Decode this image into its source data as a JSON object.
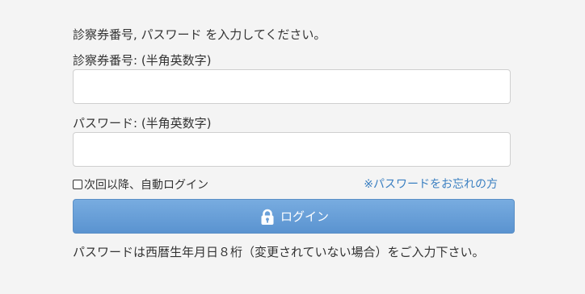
{
  "form": {
    "instruction": "診察券番号, パスワード を入力してください。",
    "card_number": {
      "label": "診察券番号: (半角英数字)",
      "value": ""
    },
    "password": {
      "label": "パスワード: (半角英数字)",
      "value": ""
    },
    "remember_me": {
      "label": "次回以降、自動ログイン",
      "checked": false
    },
    "forgot_password_link": "※パスワードをお忘れの方",
    "login_button": {
      "label": "ログイン",
      "icon": "lock-icon"
    },
    "password_note": "パスワードは西暦生年月日８桁（変更されていない場合）をご入力下さい。"
  },
  "colors": {
    "background": "#f4f4f4",
    "link": "#3a7fc1",
    "button_top": "#78ace0",
    "button_bottom": "#5a93d0"
  }
}
